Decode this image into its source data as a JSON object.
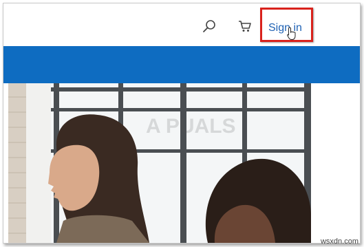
{
  "header": {
    "signin_label": "Sign in",
    "search_icon": "search-icon",
    "cart_icon": "cart-icon"
  },
  "hero": {
    "image_description_icon": "hero-photo"
  },
  "watermark": "wsxdn.com",
  "colors": {
    "accent_blue": "#0e6cc1",
    "link_blue": "#1f62b4",
    "highlight_red": "#d9221c"
  }
}
